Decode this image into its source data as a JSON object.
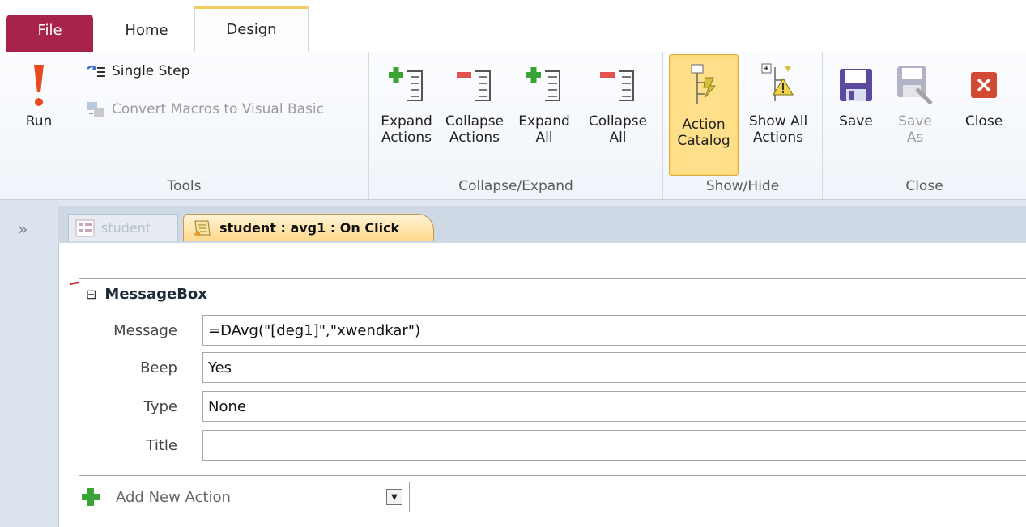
{
  "tabs": {
    "file": "File",
    "home": "Home",
    "design": "Design"
  },
  "ribbon": {
    "tools": {
      "run": "Run",
      "single_step": "Single Step",
      "convert": "Convert Macros to Visual Basic",
      "label": "Tools"
    },
    "collapse_expand": {
      "expand_actions": [
        "Expand",
        "Actions"
      ],
      "collapse_actions": [
        "Collapse",
        "Actions"
      ],
      "expand_all": [
        "Expand",
        "All"
      ],
      "collapse_all": [
        "Collapse",
        "All"
      ],
      "label": "Collapse/Expand"
    },
    "show_hide": {
      "action_catalog": [
        "Action",
        "Catalog"
      ],
      "show_all_actions": [
        "Show All",
        "Actions"
      ],
      "label": "Show/Hide"
    },
    "close_group": {
      "save": "Save",
      "save_as": [
        "Save",
        "As"
      ],
      "close": "Close",
      "label": "Close"
    }
  },
  "doc_tabs": {
    "form": "student",
    "macro": "student : avg1 : On Click"
  },
  "nav": {
    "chevron": "»"
  },
  "macro": {
    "action": "MessageBox",
    "collapse_glyph": "⊟",
    "args": [
      {
        "label": "Message",
        "value": "=DAvg(\"[deg1]\",\"xwendkar\")"
      },
      {
        "label": "Beep",
        "value": "Yes"
      },
      {
        "label": "Type",
        "value": "None"
      },
      {
        "label": "Title",
        "value": ""
      }
    ],
    "add_new_action": "Add New Action"
  },
  "colors": {
    "file_tab": "#a8234c",
    "highlight": "#ffe08a",
    "annotation": "#d21f1f"
  }
}
